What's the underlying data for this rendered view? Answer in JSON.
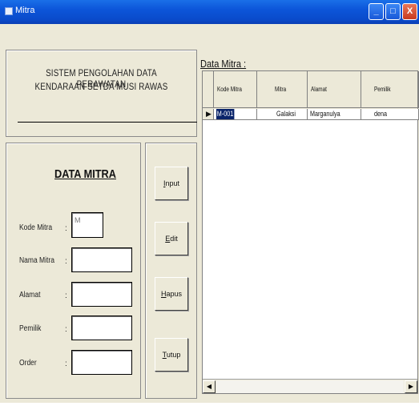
{
  "window": {
    "title": "Mitra",
    "controls": {
      "minimize": "_",
      "maximize": "□",
      "close": "X"
    }
  },
  "header": {
    "line1": "SISTEM PENGOLAHAN DATA PERAWATAN",
    "line2": "KENDARAAN SETDA MUSI RAWAS"
  },
  "form": {
    "heading": "DATA MITRA",
    "colon": ":",
    "fields": [
      {
        "label": "Kode Mitra",
        "value": "M"
      },
      {
        "label": "Nama Mitra",
        "value": ""
      },
      {
        "label": "Alamat",
        "value": ""
      },
      {
        "label": "Pemilik",
        "value": ""
      },
      {
        "label": "Order",
        "value": ""
      }
    ]
  },
  "buttons": [
    {
      "hotkey": "I",
      "rest": "nput"
    },
    {
      "hotkey": "E",
      "rest": "dit"
    },
    {
      "hotkey": "H",
      "rest": "apus"
    },
    {
      "hotkey": "T",
      "rest": "utup"
    }
  ],
  "grid": {
    "label": "Data Mitra :",
    "columns": [
      "Kode Mitra",
      "Mitra",
      "Alamat",
      "Pemilik"
    ],
    "rows": [
      {
        "selector": "▶",
        "kode": "M-001",
        "mitra": "Galaksi",
        "alamat": "Marganulya",
        "pemilik": "dena"
      }
    ],
    "scroll_left": "◀",
    "scroll_right": "▶"
  }
}
